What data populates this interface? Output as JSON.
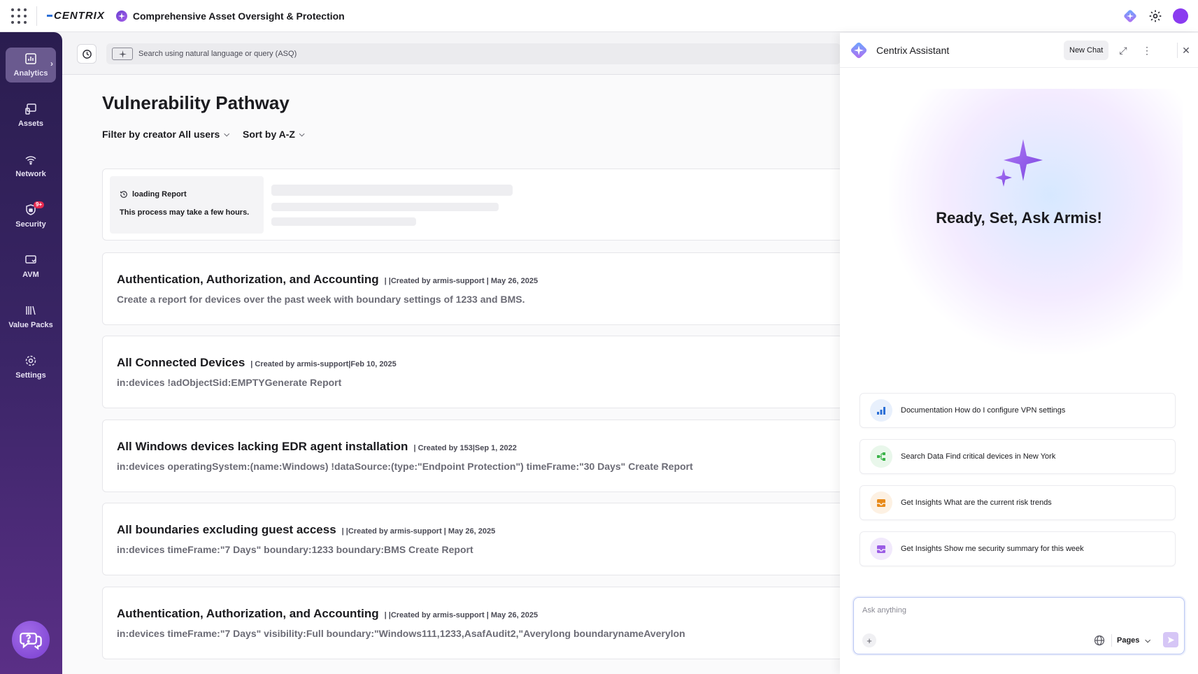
{
  "topbar": {
    "logo_text": "CENTRIX",
    "app_title": "Comprehensive Asset Oversight & Protection"
  },
  "sidebar": {
    "items": [
      {
        "label": "Analytics",
        "icon": "analytics-icon",
        "active": true
      },
      {
        "label": "Assets",
        "icon": "assets-icon"
      },
      {
        "label": "Network",
        "icon": "network-icon"
      },
      {
        "label": "Security",
        "icon": "security-icon",
        "badge": "9+"
      },
      {
        "label": "AVM",
        "icon": "avm-icon"
      },
      {
        "label": "Value Packs",
        "icon": "value-packs-icon"
      },
      {
        "label": "Settings",
        "icon": "gear-icon"
      }
    ]
  },
  "search": {
    "placeholder": "Search using natural language or query (ASQ)"
  },
  "main": {
    "title": "Vulnerability Pathway",
    "filter_label": "Filter by creator All users",
    "sort_label": "Sort by A-Z",
    "loading": {
      "title": "loading Report",
      "subtitle": "This process may take a few hours."
    },
    "reports": [
      {
        "name": "Authentication, Authorization, and Accounting",
        "meta": "| |Created by armis-support | May 26, 2025",
        "desc": "Create a report for devices over the past week with boundary settings of 1233 and BMS."
      },
      {
        "name": "All Connected Devices",
        "meta": "| Created by armis-support|Feb 10, 2025",
        "desc": "in:devices !adObjectSid:EMPTYGenerate Report"
      },
      {
        "name": "All Windows devices lacking EDR agent installation",
        "meta": "| Created by 153|Sep 1, 2022",
        "desc": "in:devices operatingSystem:(name:Windows) !dataSource:(type:\"Endpoint Protection\") timeFrame:\"30 Days\" Create Report"
      },
      {
        "name": "All boundaries excluding guest access",
        "meta": "| |Created by armis-support | May 26, 2025",
        "desc": "in:devices timeFrame:\"7 Days\" boundary:1233 boundary:BMS Create Report"
      },
      {
        "name": "Authentication, Authorization, and Accounting",
        "meta": "| |Created by armis-support | May 26, 2025",
        "desc": "in:devices timeFrame:\"7 Days\" visibility:Full boundary:\"Windows111,1233,AsafAudit2,\"Averylong boundarynameAverylon"
      }
    ]
  },
  "assistant": {
    "title": "Centrix Assistant",
    "new_chat_label": "New Chat",
    "headline": "Ready, Set, Ask Armis!",
    "suggestions": [
      {
        "text": "Documentation How do I configure VPN settings",
        "icon": "bar-chart-icon",
        "color": "#2b6fd6"
      },
      {
        "text": "Search Data Find critical devices in New York",
        "icon": "nodes-icon",
        "color": "#3cb44a"
      },
      {
        "text": "Get Insights What are the current risk trends",
        "icon": "inbox-icon",
        "color": "#e88a1a"
      },
      {
        "text": "Get Insights Show me security summary for this week",
        "icon": "inbox-icon",
        "color": "#9b5de5"
      }
    ],
    "composer": {
      "placeholder": "Ask anything",
      "mode_label": "Pages"
    }
  },
  "colors": {
    "accent": "#8a3bf0",
    "sidebar_top": "#2a1d4f",
    "sidebar_bottom": "#5a2f86"
  }
}
